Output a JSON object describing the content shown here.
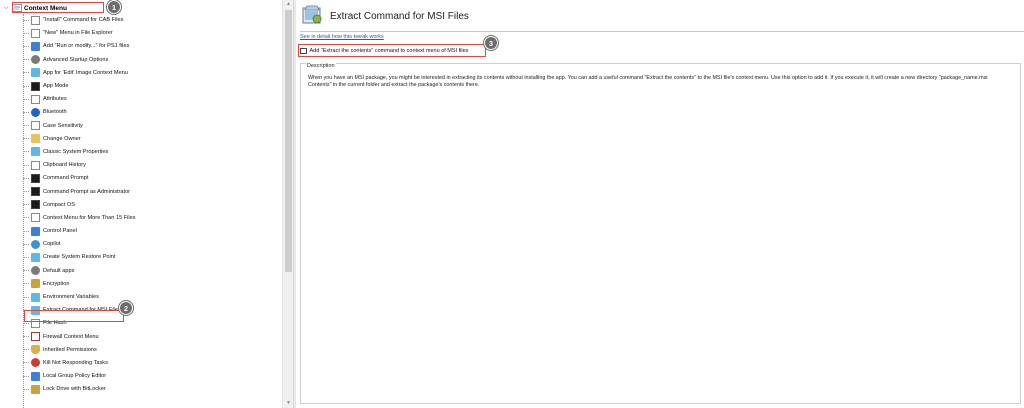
{
  "tree": {
    "root_label": "Context Menu",
    "items": [
      {
        "label": "\"Install\" Command for CAB Files",
        "icon": "page-icon"
      },
      {
        "label": "\"New\" Menu in File Explorer",
        "icon": "page-icon"
      },
      {
        "label": "Add \"Run or modify...\" for PS1 files",
        "icon": "blue-window-icon"
      },
      {
        "label": "Advanced Startup Options",
        "icon": "gear-icon"
      },
      {
        "label": "App for 'Edit' Image Context Menu",
        "icon": "image-icon"
      },
      {
        "label": "App Mode",
        "icon": "black-window-icon"
      },
      {
        "label": "Attributes",
        "icon": "page-icon"
      },
      {
        "label": "Bluetooth",
        "icon": "bluetooth-icon"
      },
      {
        "label": "Case Sensitivity",
        "icon": "page-icon"
      },
      {
        "label": "Change Owner",
        "icon": "user-icon"
      },
      {
        "label": "Classic System Properties",
        "icon": "computer-icon"
      },
      {
        "label": "Clipboard History",
        "icon": "clipboard-icon"
      },
      {
        "label": "Command Prompt",
        "icon": "console-icon"
      },
      {
        "label": "Command Prompt as Administrator",
        "icon": "console-icon"
      },
      {
        "label": "Compact OS",
        "icon": "black-window-icon"
      },
      {
        "label": "Context Menu for More Than 15 Files",
        "icon": "page-icon"
      },
      {
        "label": "Control Panel",
        "icon": "control-panel-icon"
      },
      {
        "label": "Copilot",
        "icon": "copilot-icon"
      },
      {
        "label": "Create System Restore Point",
        "icon": "restore-icon"
      },
      {
        "label": "Default apps",
        "icon": "gear-icon"
      },
      {
        "label": "Encryption",
        "icon": "lock-icon"
      },
      {
        "label": "Environment Variables",
        "icon": "computer-icon"
      },
      {
        "label": "Extract Command for MSI Files",
        "icon": "msi-package-icon"
      },
      {
        "label": "File Hash",
        "icon": "page-icon"
      },
      {
        "label": "Firewall Context Menu",
        "icon": "firewall-icon"
      },
      {
        "label": "Inherited Permissions",
        "icon": "shield-icon"
      },
      {
        "label": "Kill Not Responding Tasks",
        "icon": "red-x-icon"
      },
      {
        "label": "Local Group Policy Editor",
        "icon": "policy-icon"
      },
      {
        "label": "Lock Drive with BitLocker",
        "icon": "lock-icon"
      }
    ]
  },
  "badges": {
    "one": "1",
    "two": "2",
    "three": "3"
  },
  "content": {
    "title": "Extract Command for MSI Files",
    "details_link": "See in detail how this tweak works",
    "option_label": "Add \"Extract the contents\" command to context menu of MSI files",
    "option_checked": false,
    "description_legend": "Description",
    "description_text": "When you have an MSI package, you might be interested in extracting its contents without installing the app. You can add a useful command \"Extract the contents\" to the MSI file's context menu. Use this option to add it. If you execute it, it will create a new directory \"package_name.msi Contents\" in the current folder and extract the package's contents there."
  },
  "colors": {
    "highlight": "#e0473f",
    "link": "#1a5ad1",
    "badge": "#6d6d6d"
  }
}
